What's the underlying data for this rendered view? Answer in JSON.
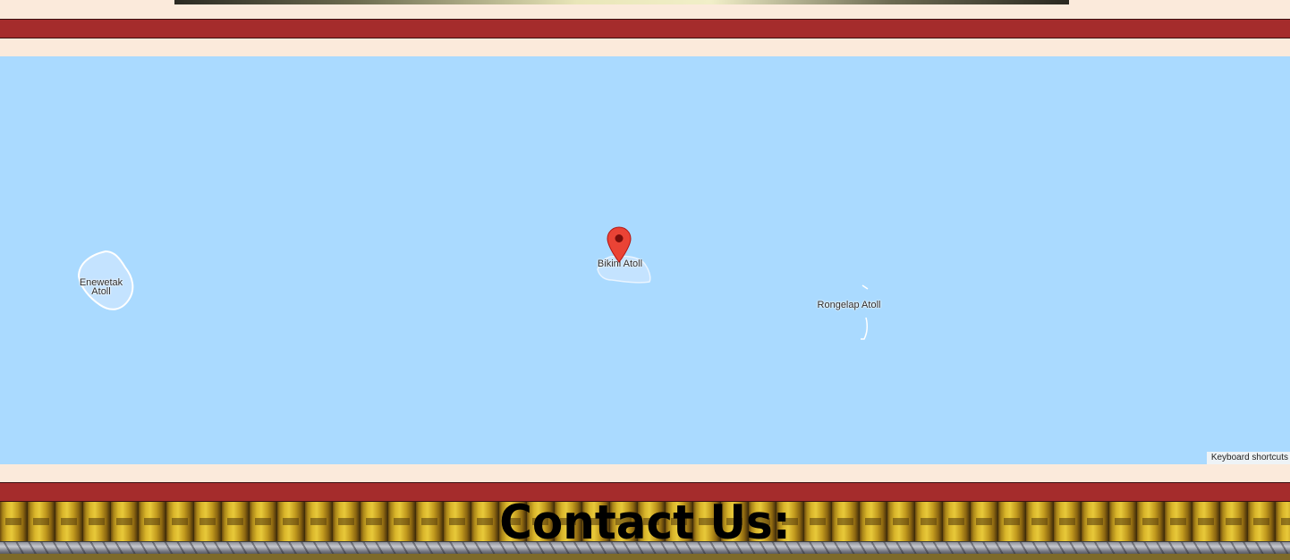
{
  "map": {
    "pin_label": "Bikini Atoll",
    "places": {
      "enewetak": "Enewetak\nAtoll",
      "bikini": "Bikini Atoll",
      "rongelap": "Rongelap Atoll"
    },
    "keyboard_shortcuts": "Keyboard shortcuts",
    "colors": {
      "water": "#aadaff",
      "pin": "#ea4335"
    }
  },
  "footer": {
    "title": "Contact Us:"
  },
  "theme": {
    "background": "#fbeadb",
    "divider": "#a52c2c"
  }
}
